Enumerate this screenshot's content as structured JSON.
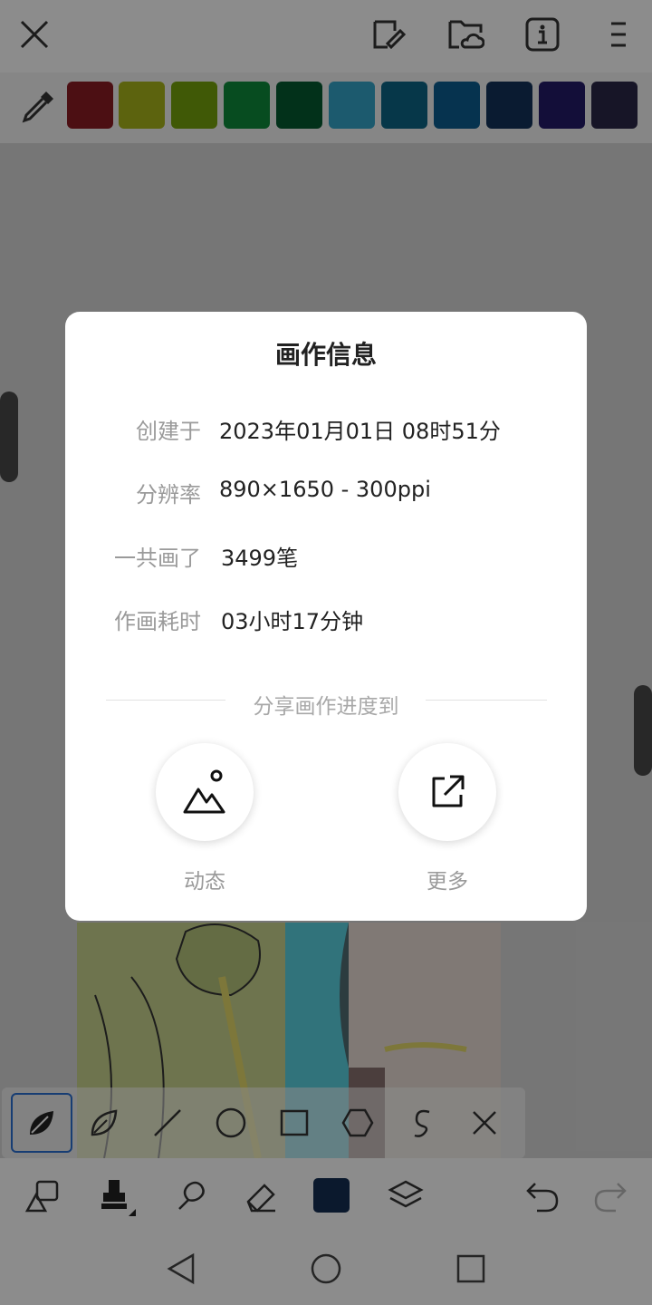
{
  "palette": {
    "colors": [
      "#8a1d24",
      "#a8b41b",
      "#75a20c",
      "#0d8a3b",
      "#045a30",
      "#33a5c8",
      "#0c6586",
      "#0c5e90",
      "#13325a",
      "#241b69",
      "#2b2748"
    ]
  },
  "dialog": {
    "title": "画作信息",
    "rows": [
      {
        "label": "创建于",
        "value": "2023年01月01日 08时51分"
      },
      {
        "label": "分辨率",
        "value": "890×1650 - 300ppi"
      },
      {
        "label": "一共画了",
        "value": "3499笔"
      },
      {
        "label": "作画耗时",
        "value": "03小时17分钟"
      }
    ],
    "share_title": "分享画作进度到",
    "share_options": [
      {
        "label": "动态",
        "icon": "mountain-image-icon"
      },
      {
        "label": "更多",
        "icon": "external-share-icon"
      }
    ]
  },
  "toolbar": {
    "top_icons": [
      "close-icon",
      "edit-doc-icon",
      "cloud-folder-icon",
      "info-icon",
      "menu-icon"
    ],
    "current_color": "#152f52"
  }
}
